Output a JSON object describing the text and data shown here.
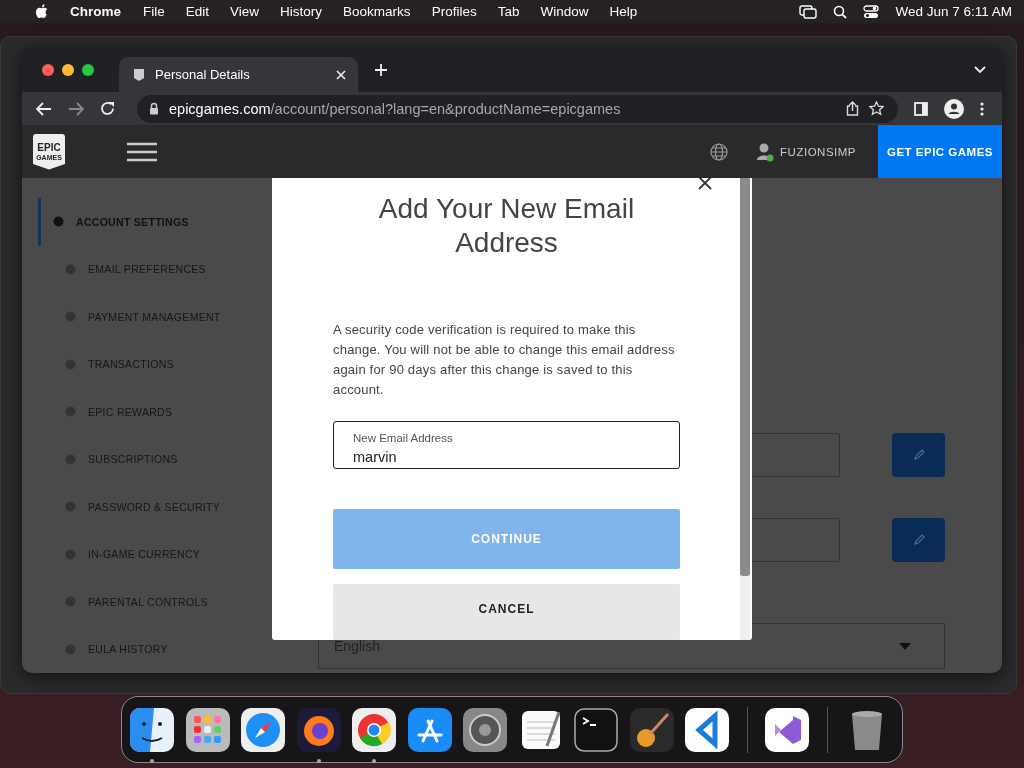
{
  "menu_bar": {
    "app": "Chrome",
    "menus": [
      "File",
      "Edit",
      "View",
      "History",
      "Bookmarks",
      "Profiles",
      "Tab",
      "Window",
      "Help"
    ],
    "clock": "Wed Jun 7  6:11 AM"
  },
  "browser": {
    "tabs": [
      {
        "title": "Personal Details",
        "selected": true
      }
    ],
    "address": {
      "domain": "epicgames.com",
      "path": "/account/personal?lang=en&productName=epicgames"
    }
  },
  "site_header": {
    "logo": [
      "EPIC",
      "GAMES"
    ],
    "username": "FUZIONSIMP",
    "cta": "GET EPIC GAMES"
  },
  "sidebar": {
    "items": [
      {
        "label": "ACCOUNT SETTINGS",
        "selected": true
      },
      {
        "label": "EMAIL PREFERENCES",
        "selected": false
      },
      {
        "label": "PAYMENT MANAGEMENT",
        "selected": false
      },
      {
        "label": "TRANSACTIONS",
        "selected": false
      },
      {
        "label": "EPIC REWARDS",
        "selected": false
      },
      {
        "label": "SUBSCRIPTIONS",
        "selected": false
      },
      {
        "label": "PASSWORD & SECURITY",
        "selected": false
      },
      {
        "label": "IN-GAME CURRENCY",
        "selected": false
      },
      {
        "label": "PARENTAL CONTROLS",
        "selected": false
      },
      {
        "label": "EULA HISTORY",
        "selected": false
      }
    ]
  },
  "page": {
    "language": "English"
  },
  "modal": {
    "title": "Add Your New Email Address",
    "message": "A security code verification is required to make this change. You will not be able to change this email address again for 90 days after this change is saved to this account.",
    "field": {
      "label": "New Email Address",
      "value": "marvin"
    },
    "continue": {
      "label": "CONTINUE",
      "disabled": true
    },
    "cancel": "CANCEL"
  },
  "dock": [
    {
      "running": true
    },
    {
      "running": false
    },
    {
      "running": false
    },
    {
      "running": true
    },
    {
      "running": true
    },
    {
      "running": false
    },
    {
      "running": false
    },
    {
      "running": false
    },
    {
      "running": false
    },
    {
      "running": false
    },
    {
      "running": false
    },
    {
      "running": false
    },
    {
      "running": false
    }
  ]
}
